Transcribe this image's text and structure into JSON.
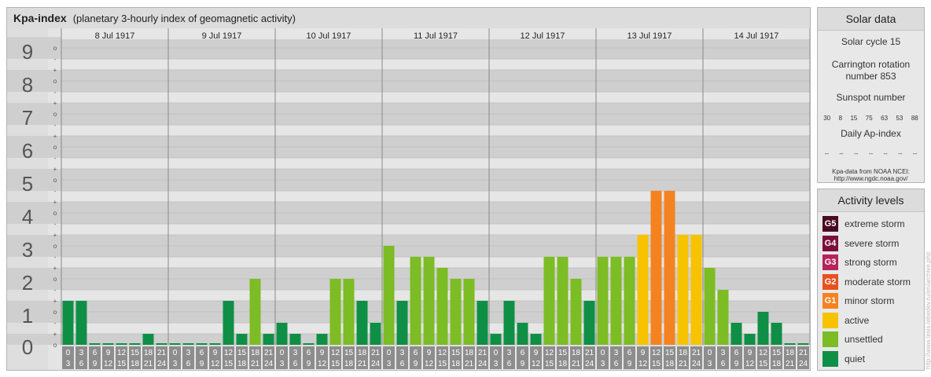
{
  "header": {
    "title": "Kpa-index",
    "subtitle": "(planetary 3-hourly index of geomagnetic activity)"
  },
  "chart_data": {
    "type": "bar",
    "title": "Kpa-index",
    "subtitle": "(planetary 3-hourly index of geomagnetic activity)",
    "ylim": [
      0,
      9
    ],
    "y_ticks": [
      "0",
      "1",
      "2",
      "3",
      "4",
      "5",
      "6",
      "7",
      "8",
      "9"
    ],
    "minor_tick_labels": [
      "o",
      "+",
      "-"
    ],
    "days": [
      "8 Jul 1917",
      "9 Jul 1917",
      "10 Jul 1917",
      "11 Jul 1917",
      "12 Jul 1917",
      "13 Jul 1917",
      "14 Jul 1917"
    ],
    "interval_start": [
      "0",
      "3",
      "6",
      "9",
      "12",
      "15",
      "18",
      "21"
    ],
    "interval_end": [
      "3",
      "6",
      "9",
      "12",
      "15",
      "18",
      "21",
      "24"
    ],
    "values": [
      1.333,
      1.333,
      0,
      0,
      0,
      0,
      0.333,
      0,
      0,
      0,
      0,
      0,
      1.333,
      0.333,
      2,
      0.333,
      0.667,
      0.333,
      0,
      0.333,
      2,
      2,
      1.333,
      0.667,
      3,
      1.333,
      2.667,
      2.667,
      2.333,
      2,
      2,
      1.333,
      0.333,
      1.333,
      0.667,
      0.333,
      2.667,
      2.667,
      2,
      1.333,
      2.667,
      2.667,
      2.667,
      3.333,
      4.667,
      4.667,
      3.333,
      3.333,
      2.333,
      1.667,
      0.667,
      0.333,
      1,
      0.667,
      0,
      0
    ],
    "levels": [
      "quiet",
      "quiet",
      "quiet",
      "quiet",
      "quiet",
      "quiet",
      "quiet",
      "quiet",
      "quiet",
      "quiet",
      "quiet",
      "quiet",
      "quiet",
      "quiet",
      "unsettled",
      "quiet",
      "quiet",
      "quiet",
      "quiet",
      "quiet",
      "unsettled",
      "unsettled",
      "quiet",
      "quiet",
      "unsettled",
      "quiet",
      "unsettled",
      "unsettled",
      "unsettled",
      "unsettled",
      "unsettled",
      "quiet",
      "quiet",
      "quiet",
      "quiet",
      "quiet",
      "unsettled",
      "unsettled",
      "unsettled",
      "quiet",
      "unsettled",
      "unsettled",
      "unsettled",
      "active",
      "minor storm",
      "minor storm",
      "active",
      "active",
      "unsettled",
      "unsettled",
      "quiet",
      "quiet",
      "quiet",
      "quiet",
      "quiet",
      "quiet"
    ],
    "colors": {
      "quiet": "#0f8f46",
      "unsettled": "#7cbc24",
      "active": "#f7c300",
      "minor storm": "#f58220",
      "moderate storm": "#e8521f",
      "strong storm": "#b6235d",
      "severe storm": "#7a0f3c",
      "extreme storm": "#4a0a22"
    },
    "grid": true
  },
  "solar": {
    "heading": "Solar data",
    "cycle": "Solar cycle 15",
    "carrington": "Carrington rotation number 853",
    "sunspot_label": "Sunspot number",
    "sunspot_values": [
      "30",
      "8",
      "15",
      "75",
      "63",
      "53",
      "88"
    ],
    "ap_label": "Daily Ap-index",
    "ap_values": [
      "--",
      "--",
      "--",
      "--",
      "--",
      "--",
      "--"
    ],
    "source_1": "Kpa-data from NOAA NCEI:",
    "source_2": "http://www.ngdc.noaa.gov/"
  },
  "activity": {
    "heading": "Activity levels",
    "items": [
      {
        "badge": "G5",
        "label": "extreme storm",
        "color": "#4a0a22"
      },
      {
        "badge": "G4",
        "label": "severe storm",
        "color": "#7a0f3c"
      },
      {
        "badge": "G3",
        "label": "strong storm",
        "color": "#b6235d"
      },
      {
        "badge": "G2",
        "label": "moderate storm",
        "color": "#e8521f"
      },
      {
        "badge": "G1",
        "label": "minor storm",
        "color": "#f58220"
      },
      {
        "badge": "",
        "label": "active",
        "color": "#f7c300"
      },
      {
        "badge": "",
        "label": "unsettled",
        "color": "#7cbc24"
      },
      {
        "badge": "",
        "label": "quiet",
        "color": "#0f8f46"
      }
    ]
  },
  "watermark": "http://www.tesis.lebedev.ru/en/archive.php"
}
